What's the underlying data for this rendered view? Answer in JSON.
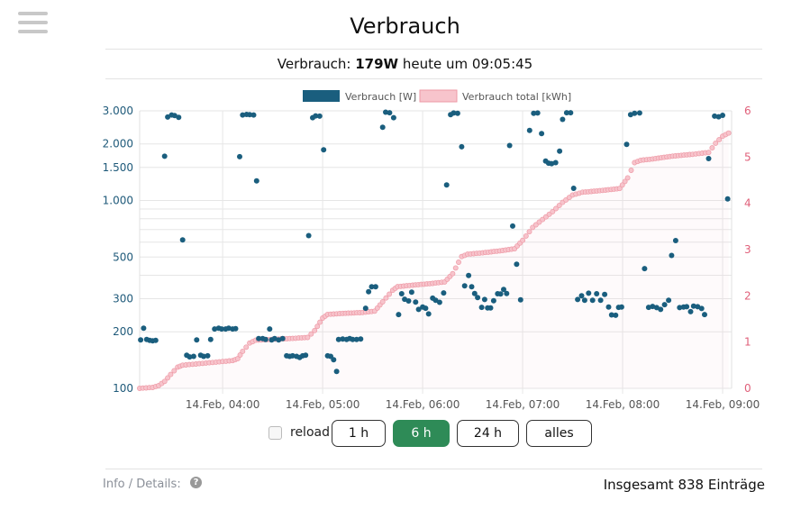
{
  "page": {
    "title": "Verbrauch"
  },
  "status": {
    "prefix": "Verbrauch: ",
    "power": "179W",
    "suffix": " heute um 09:05:45"
  },
  "controls": {
    "reload_label": "reload",
    "buttons": [
      {
        "label": "1 h",
        "active": false
      },
      {
        "label": "6 h",
        "active": true
      },
      {
        "label": "24 h",
        "active": false
      },
      {
        "label": "alles",
        "active": false
      }
    ]
  },
  "footer": {
    "info_label": "Info / Details:",
    "help_icon": "question-circle-icon",
    "total_text": "Insgesamt 838 Einträge"
  },
  "colors": {
    "power": "#1a5e7e",
    "energy_fill": "#f7c4cc",
    "energy_line": "#ee9aa6",
    "left_axis": "#1f5a7a",
    "right_axis": "#e0607a",
    "active_button": "#2e8b57"
  },
  "chart_data": {
    "type": "scatter",
    "x_unit": "time of day (hours, 14.Feb)",
    "xlim": [
      3.17,
      9.09
    ],
    "x_ticks": [
      {
        "x": 4.0,
        "label": "14.Feb, 04:00"
      },
      {
        "x": 5.0,
        "label": "14.Feb, 05:00"
      },
      {
        "x": 6.0,
        "label": "14.Feb, 06:00"
      },
      {
        "x": 7.0,
        "label": "14.Feb, 07:00"
      },
      {
        "x": 8.0,
        "label": "14.Feb, 08:00"
      },
      {
        "x": 9.0,
        "label": "14.Feb, 09:00"
      }
    ],
    "y_left": {
      "scale": "log",
      "range": [
        100,
        3000
      ],
      "ticks": [
        {
          "v": 100,
          "label": "100"
        },
        {
          "v": 200,
          "label": "200"
        },
        {
          "v": 300,
          "label": "300"
        },
        {
          "v": 500,
          "label": "500"
        },
        {
          "v": 1000,
          "label": "1.000"
        },
        {
          "v": 1500,
          "label": "1.500"
        },
        {
          "v": 2000,
          "label": "2.000"
        },
        {
          "v": 3000,
          "label": "3.000"
        }
      ],
      "minor_gridlines": [
        400,
        600,
        700,
        800,
        900
      ]
    },
    "y_right": {
      "scale": "linear",
      "range": [
        0,
        6
      ],
      "ticks": [
        {
          "v": 0,
          "label": "0"
        },
        {
          "v": 1,
          "label": "1"
        },
        {
          "v": 2,
          "label": "2"
        },
        {
          "v": 3,
          "label": "3"
        },
        {
          "v": 4,
          "label": "4"
        },
        {
          "v": 5,
          "label": "5"
        },
        {
          "v": 6,
          "label": "6"
        }
      ]
    },
    "grid": true,
    "legend": {
      "position": "top-center"
    },
    "series": [
      {
        "name": "Verbrauch [W]",
        "axis": "left",
        "style": "dots",
        "points": [
          [
            3.18,
            181
          ],
          [
            3.21,
            209
          ],
          [
            3.24,
            182
          ],
          [
            3.27,
            180
          ],
          [
            3.3,
            179
          ],
          [
            3.33,
            180
          ],
          [
            3.42,
            1720
          ],
          [
            3.45,
            2780
          ],
          [
            3.49,
            2850
          ],
          [
            3.52,
            2830
          ],
          [
            3.56,
            2770
          ],
          [
            3.6,
            617
          ],
          [
            3.64,
            150
          ],
          [
            3.67,
            147
          ],
          [
            3.71,
            148
          ],
          [
            3.74,
            181
          ],
          [
            3.78,
            150
          ],
          [
            3.81,
            148
          ],
          [
            3.85,
            149
          ],
          [
            3.88,
            182
          ],
          [
            3.92,
            207
          ],
          [
            3.96,
            209
          ],
          [
            3.99,
            207
          ],
          [
            4.03,
            207
          ],
          [
            4.06,
            209
          ],
          [
            4.1,
            207
          ],
          [
            4.13,
            208
          ],
          [
            4.17,
            1710
          ],
          [
            4.2,
            2850
          ],
          [
            4.24,
            2870
          ],
          [
            4.27,
            2860
          ],
          [
            4.31,
            2850
          ],
          [
            4.34,
            1270
          ],
          [
            4.36,
            184
          ],
          [
            4.4,
            184
          ],
          [
            4.43,
            182
          ],
          [
            4.47,
            207
          ],
          [
            4.49,
            181
          ],
          [
            4.52,
            184
          ],
          [
            4.56,
            181
          ],
          [
            4.6,
            184
          ],
          [
            4.64,
            149
          ],
          [
            4.67,
            148
          ],
          [
            4.7,
            149
          ],
          [
            4.74,
            148
          ],
          [
            4.77,
            146
          ],
          [
            4.8,
            149
          ],
          [
            4.83,
            150
          ],
          [
            4.86,
            650
          ],
          [
            4.9,
            2760
          ],
          [
            4.93,
            2820
          ],
          [
            4.97,
            2810
          ],
          [
            5.01,
            1860
          ],
          [
            5.05,
            149
          ],
          [
            5.08,
            148
          ],
          [
            5.11,
            142
          ],
          [
            5.14,
            123
          ],
          [
            5.16,
            182
          ],
          [
            5.2,
            183
          ],
          [
            5.24,
            182
          ],
          [
            5.27,
            184
          ],
          [
            5.3,
            182
          ],
          [
            5.34,
            182
          ],
          [
            5.38,
            183
          ],
          [
            5.43,
            267
          ],
          [
            5.46,
            327
          ],
          [
            5.49,
            347
          ],
          [
            5.53,
            347
          ],
          [
            5.6,
            2450
          ],
          [
            5.63,
            2950
          ],
          [
            5.67,
            2930
          ],
          [
            5.71,
            2760
          ],
          [
            5.76,
            247
          ],
          [
            5.79,
            319
          ],
          [
            5.82,
            298
          ],
          [
            5.86,
            292
          ],
          [
            5.89,
            325
          ],
          [
            5.93,
            288
          ],
          [
            5.96,
            263
          ],
          [
            6.0,
            271
          ],
          [
            6.03,
            267
          ],
          [
            6.06,
            249
          ],
          [
            6.1,
            302
          ],
          [
            6.13,
            294
          ],
          [
            6.17,
            287
          ],
          [
            6.21,
            322
          ],
          [
            6.24,
            1210
          ],
          [
            6.28,
            2860
          ],
          [
            6.31,
            2920
          ],
          [
            6.35,
            2910
          ],
          [
            6.39,
            1930
          ],
          [
            6.42,
            351
          ],
          [
            6.46,
            399
          ],
          [
            6.49,
            347
          ],
          [
            6.52,
            320
          ],
          [
            6.55,
            304
          ],
          [
            6.59,
            270
          ],
          [
            6.62,
            297
          ],
          [
            6.65,
            268
          ],
          [
            6.68,
            268
          ],
          [
            6.71,
            293
          ],
          [
            6.75,
            319
          ],
          [
            6.78,
            318
          ],
          [
            6.81,
            336
          ],
          [
            6.84,
            320
          ],
          [
            6.87,
            1960
          ],
          [
            6.9,
            731
          ],
          [
            6.94,
            458
          ],
          [
            6.98,
            296
          ],
          [
            7.07,
            2360
          ],
          [
            7.11,
            2910
          ],
          [
            7.15,
            2920
          ],
          [
            7.19,
            2270
          ],
          [
            7.23,
            1620
          ],
          [
            7.26,
            1580
          ],
          [
            7.29,
            1570
          ],
          [
            7.33,
            1590
          ],
          [
            7.37,
            1830
          ],
          [
            7.4,
            2700
          ],
          [
            7.44,
            2930
          ],
          [
            7.48,
            2930
          ],
          [
            7.51,
            1160
          ],
          [
            7.55,
            297
          ],
          [
            7.59,
            311
          ],
          [
            7.62,
            294
          ],
          [
            7.66,
            321
          ],
          [
            7.7,
            294
          ],
          [
            7.74,
            319
          ],
          [
            7.78,
            294
          ],
          [
            7.82,
            316
          ],
          [
            7.86,
            271
          ],
          [
            7.89,
            246
          ],
          [
            7.93,
            245
          ],
          [
            7.96,
            270
          ],
          [
            7.99,
            271
          ],
          [
            8.04,
            1990
          ],
          [
            8.08,
            2860
          ],
          [
            8.12,
            2910
          ],
          [
            8.17,
            2920
          ],
          [
            8.22,
            434
          ],
          [
            8.26,
            270
          ],
          [
            8.3,
            273
          ],
          [
            8.34,
            269
          ],
          [
            8.38,
            263
          ],
          [
            8.42,
            279
          ],
          [
            8.46,
            294
          ],
          [
            8.49,
            510
          ],
          [
            8.53,
            612
          ],
          [
            8.57,
            269
          ],
          [
            8.61,
            271
          ],
          [
            8.64,
            272
          ],
          [
            8.68,
            256
          ],
          [
            8.71,
            274
          ],
          [
            8.75,
            272
          ],
          [
            8.79,
            266
          ],
          [
            8.82,
            247
          ],
          [
            8.86,
            1670
          ],
          [
            8.92,
            2810
          ],
          [
            8.96,
            2790
          ],
          [
            9.0,
            2840
          ],
          [
            9.05,
            1020
          ]
        ]
      },
      {
        "name": "Verbrauch total [kWh]",
        "axis": "right",
        "style": "area",
        "points": [
          [
            3.17,
            0.0
          ],
          [
            3.3,
            0.02
          ],
          [
            3.36,
            0.06
          ],
          [
            3.42,
            0.15
          ],
          [
            3.48,
            0.3
          ],
          [
            3.55,
            0.46
          ],
          [
            3.6,
            0.5
          ],
          [
            3.7,
            0.52
          ],
          [
            3.8,
            0.54
          ],
          [
            3.9,
            0.56
          ],
          [
            4.0,
            0.58
          ],
          [
            4.1,
            0.6
          ],
          [
            4.15,
            0.64
          ],
          [
            4.2,
            0.8
          ],
          [
            4.27,
            0.98
          ],
          [
            4.33,
            1.04
          ],
          [
            4.5,
            1.06
          ],
          [
            4.7,
            1.08
          ],
          [
            4.85,
            1.1
          ],
          [
            4.92,
            1.25
          ],
          [
            5.0,
            1.52
          ],
          [
            5.05,
            1.6
          ],
          [
            5.2,
            1.62
          ],
          [
            5.4,
            1.64
          ],
          [
            5.52,
            1.67
          ],
          [
            5.6,
            1.87
          ],
          [
            5.7,
            2.12
          ],
          [
            5.75,
            2.2
          ],
          [
            5.9,
            2.23
          ],
          [
            6.1,
            2.27
          ],
          [
            6.22,
            2.3
          ],
          [
            6.3,
            2.48
          ],
          [
            6.39,
            2.85
          ],
          [
            6.45,
            2.9
          ],
          [
            6.6,
            2.93
          ],
          [
            6.8,
            2.98
          ],
          [
            6.92,
            3.02
          ],
          [
            7.0,
            3.2
          ],
          [
            7.1,
            3.48
          ],
          [
            7.2,
            3.65
          ],
          [
            7.3,
            3.82
          ],
          [
            7.4,
            4.02
          ],
          [
            7.5,
            4.18
          ],
          [
            7.6,
            4.24
          ],
          [
            7.8,
            4.28
          ],
          [
            7.97,
            4.32
          ],
          [
            8.05,
            4.55
          ],
          [
            8.12,
            4.88
          ],
          [
            8.18,
            4.93
          ],
          [
            8.3,
            4.96
          ],
          [
            8.5,
            5.02
          ],
          [
            8.7,
            5.06
          ],
          [
            8.86,
            5.1
          ],
          [
            8.93,
            5.3
          ],
          [
            9.0,
            5.45
          ],
          [
            9.06,
            5.52
          ]
        ]
      }
    ]
  }
}
